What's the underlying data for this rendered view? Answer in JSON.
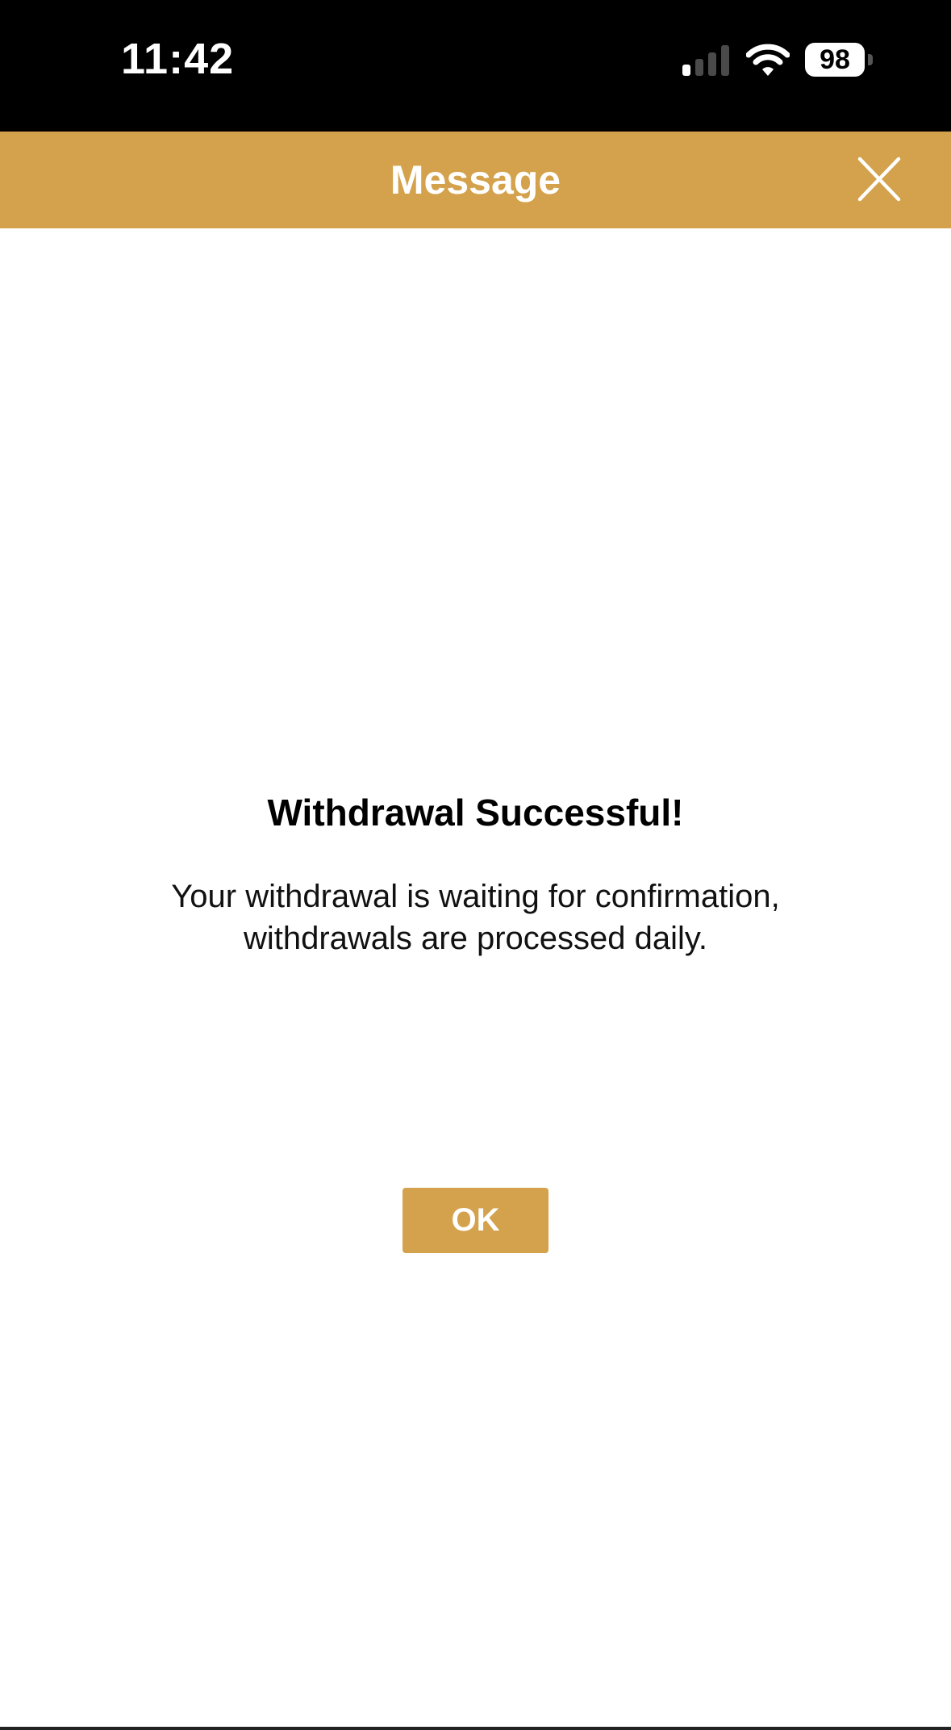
{
  "status_bar": {
    "time": "11:42",
    "battery_level": "98",
    "signal_icon": "cellular-signal-icon",
    "wifi_icon": "wifi-icon",
    "battery_icon": "battery-icon"
  },
  "header": {
    "title": "Message",
    "close_icon": "close-icon",
    "background_color": "#d4a24c"
  },
  "message": {
    "title": "Withdrawal Successful!",
    "body": "Your withdrawal is waiting for confirmation, withdrawals are processed daily."
  },
  "actions": {
    "ok_label": "OK"
  },
  "colors": {
    "accent": "#d4a24c",
    "status_bar_bg": "#000000",
    "text": "#000000",
    "button_text": "#ffffff"
  }
}
